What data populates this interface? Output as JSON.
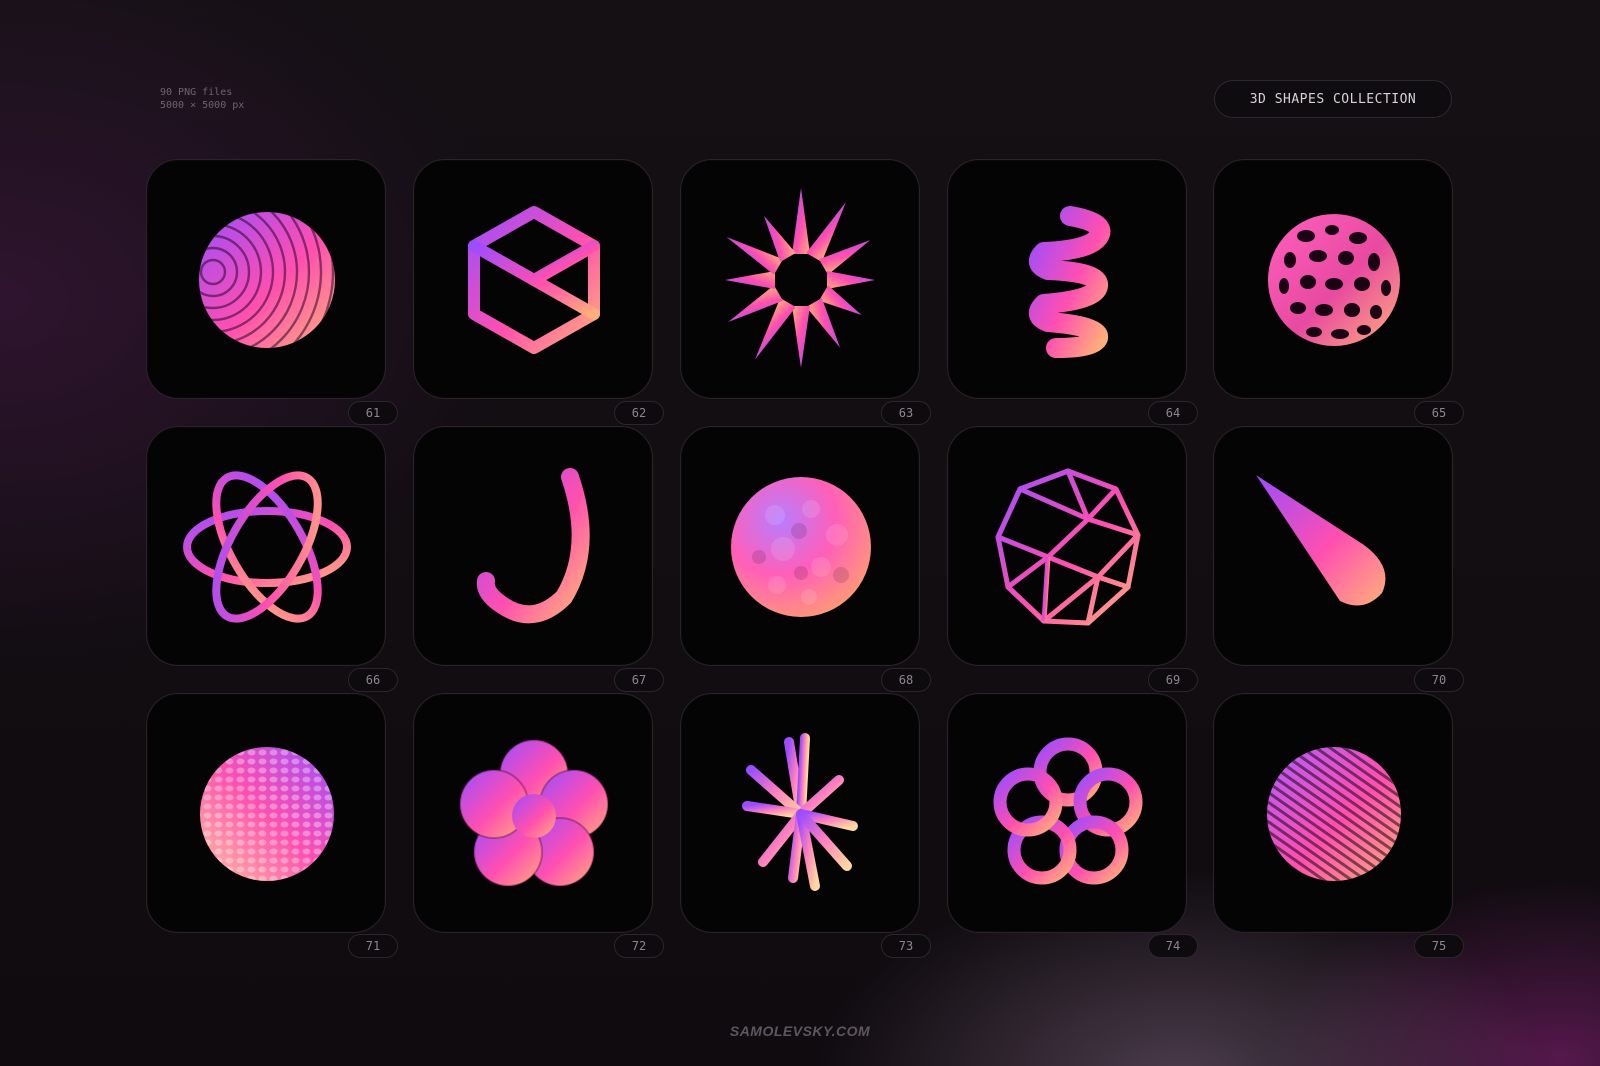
{
  "header": {
    "files_line": "90 PNG files",
    "size_line": "5000 × 5000 px",
    "collection_label": "3D SHAPES COLLECTION"
  },
  "tiles": [
    {
      "number": "61",
      "icon": "ribbed-sphere-icon"
    },
    {
      "number": "62",
      "icon": "wireframe-cube-icon"
    },
    {
      "number": "63",
      "icon": "spiky-starburst-icon"
    },
    {
      "number": "64",
      "icon": "coil-spring-icon"
    },
    {
      "number": "65",
      "icon": "voronoi-sphere-icon"
    },
    {
      "number": "66",
      "icon": "atom-orbits-icon"
    },
    {
      "number": "67",
      "icon": "j-hook-tube-icon"
    },
    {
      "number": "68",
      "icon": "bumpy-blob-icon"
    },
    {
      "number": "69",
      "icon": "geodesic-wireframe-icon"
    },
    {
      "number": "70",
      "icon": "cone-drop-icon"
    },
    {
      "number": "71",
      "icon": "pebbled-sphere-icon"
    },
    {
      "number": "72",
      "icon": "twisted-flower-icon"
    },
    {
      "number": "73",
      "icon": "asterisk-rods-icon"
    },
    {
      "number": "74",
      "icon": "pentagon-knot-icon"
    },
    {
      "number": "75",
      "icon": "lattice-sphere-icon"
    }
  ],
  "footer": {
    "site": "SAMOLEVSKY.COM"
  },
  "colors": {
    "gradient_start": "#9b4dff",
    "gradient_mid": "#ff4fb0",
    "gradient_end": "#ffb07a",
    "background": "#110d11"
  }
}
